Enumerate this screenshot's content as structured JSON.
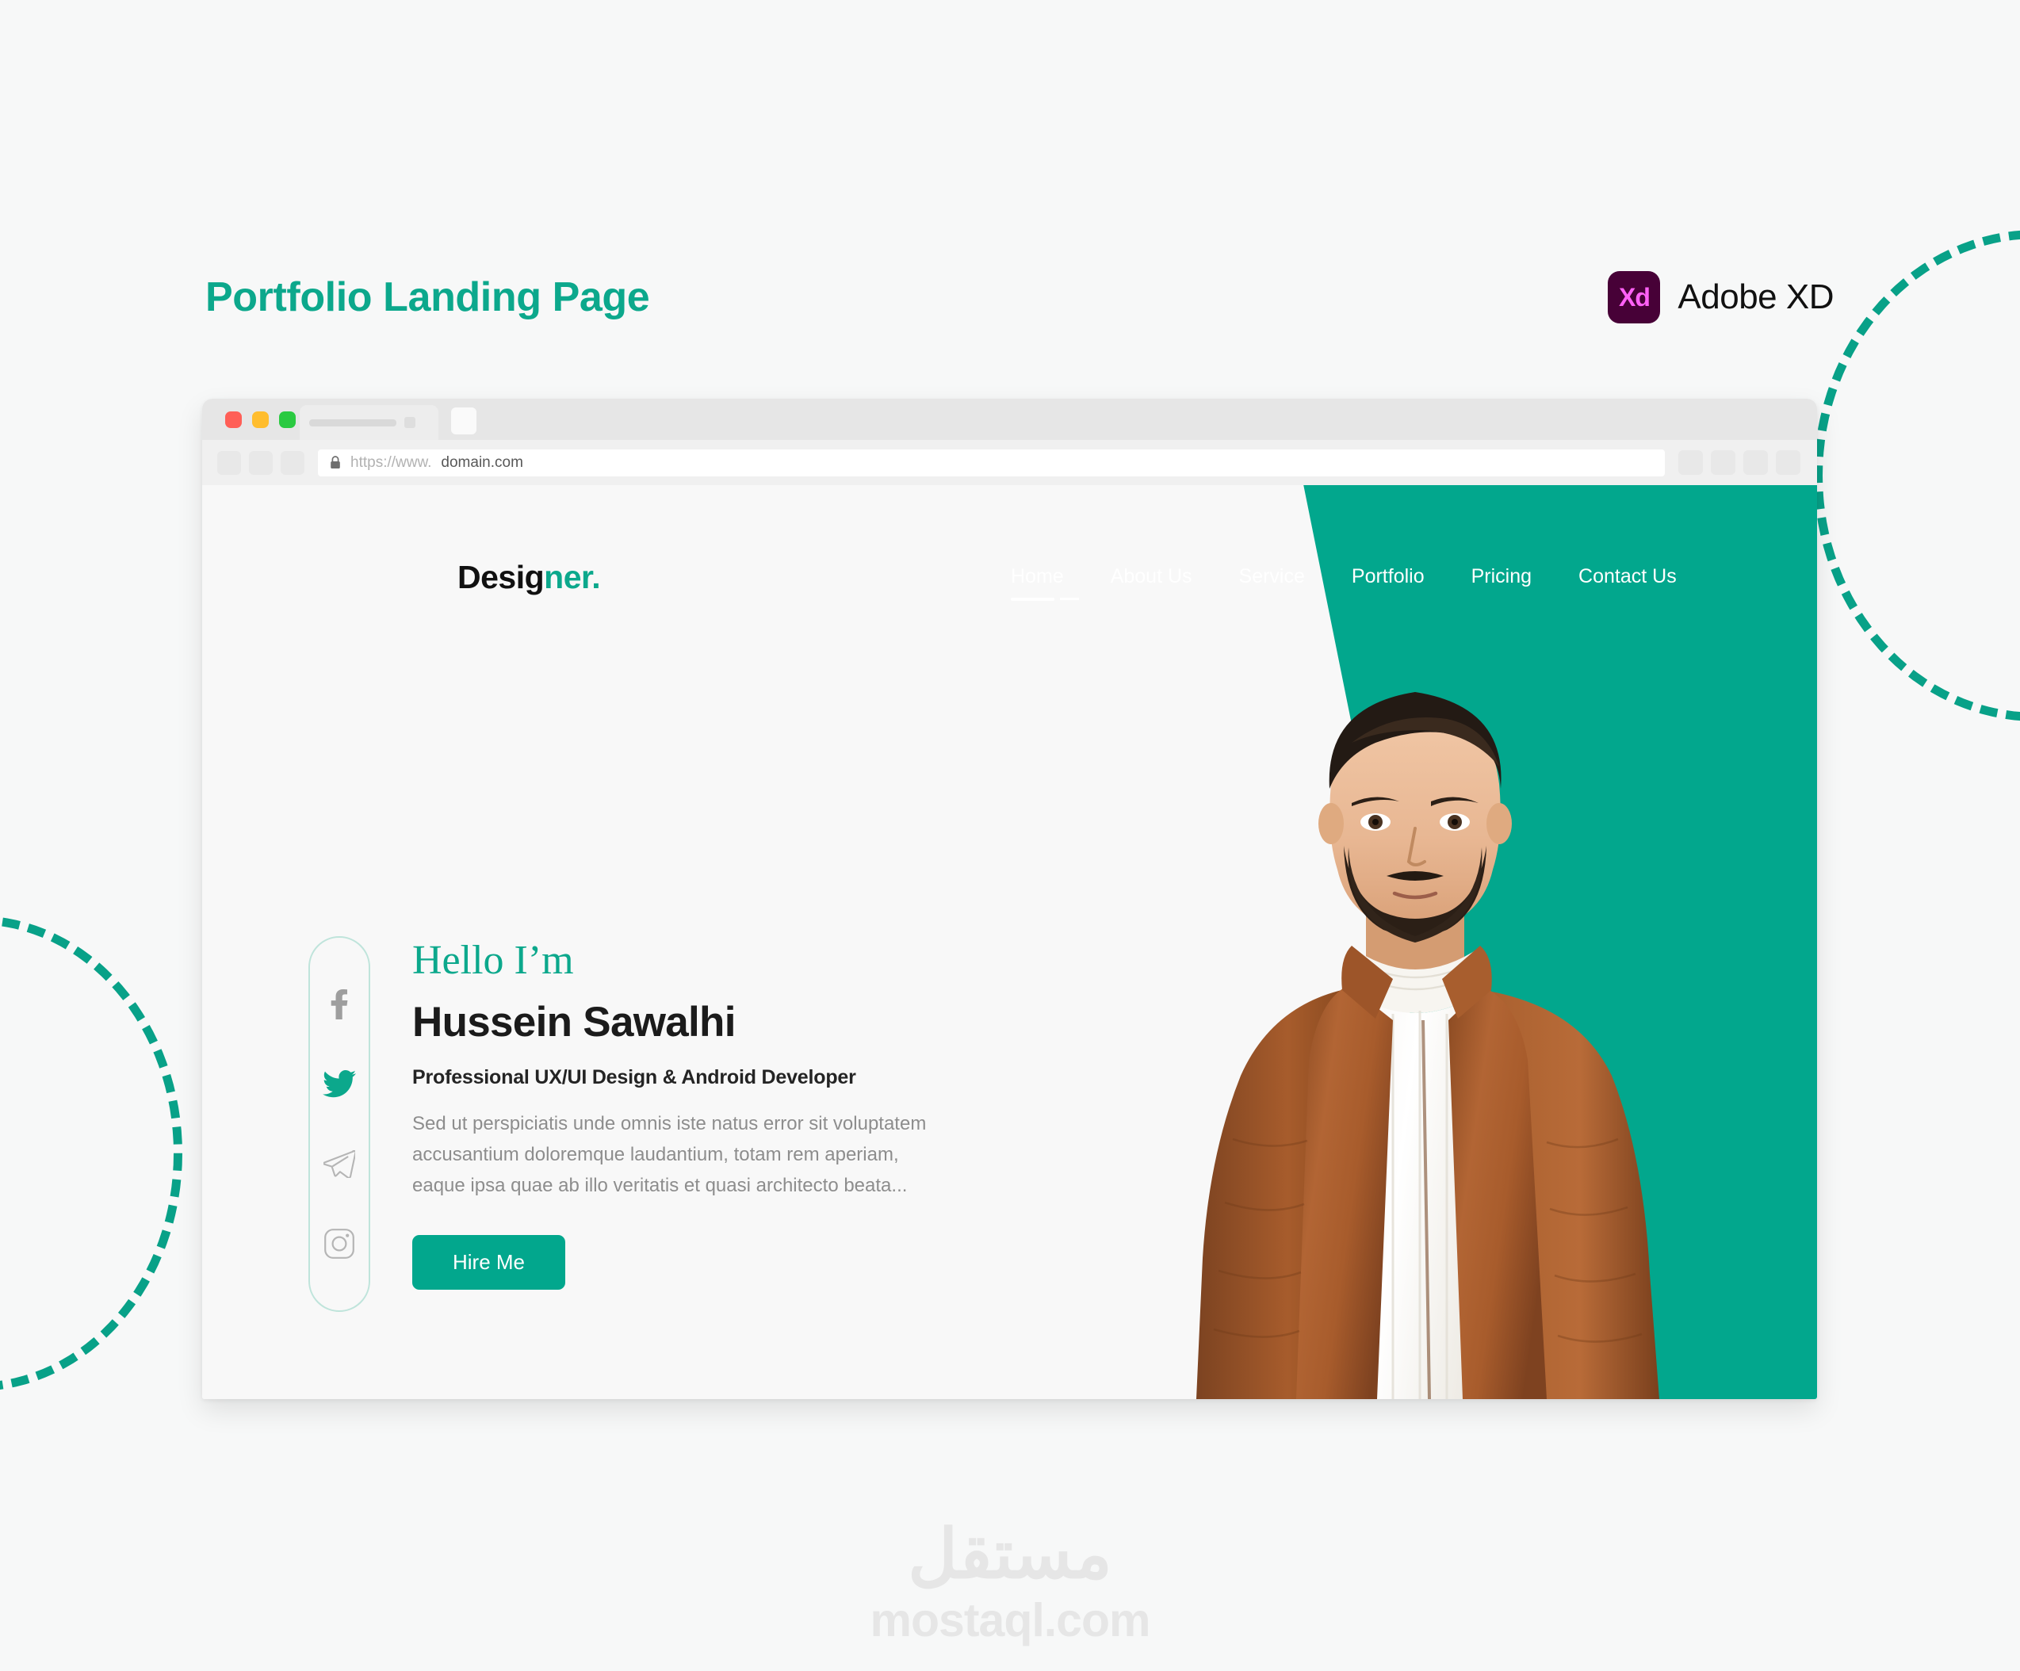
{
  "header": {
    "title": "Portfolio Landing Page",
    "tool": {
      "badge": "Xd",
      "label": "Adobe XD",
      "badge_bg": "#470137",
      "badge_fg": "#FF61F6"
    }
  },
  "browser": {
    "traffic_lights": [
      "#FF5F57",
      "#FFBD2E",
      "#2ACA41"
    ],
    "url": {
      "scheme": "https://www.",
      "domain": "domain.com",
      "lock_icon": "lock-icon"
    },
    "toolbar_icons": [
      "back-icon",
      "forward-icon",
      "reload-icon"
    ],
    "right_icons": [
      "extension-icon",
      "bookmark-icon",
      "profile-icon",
      "menu-icon"
    ]
  },
  "site": {
    "logo": {
      "dark": "Desig",
      "accent": "ner."
    },
    "nav": [
      {
        "label": "Home",
        "active": true
      },
      {
        "label": "About Us",
        "active": false
      },
      {
        "label": "Service",
        "active": false
      },
      {
        "label": "Portfolio",
        "active": false
      },
      {
        "label": "Pricing",
        "active": false
      },
      {
        "label": "Contact Us",
        "active": false
      }
    ],
    "social": [
      {
        "name": "facebook-icon",
        "color": "#9E9E9E"
      },
      {
        "name": "twitter-icon",
        "color": "#0CA88C"
      },
      {
        "name": "telegram-icon",
        "color": "#B5B5B5"
      },
      {
        "name": "instagram-icon",
        "color": "#B5B5B5"
      }
    ],
    "hero": {
      "greeting": "Hello I’m",
      "name": "Hussein Sawalhi",
      "role": "Professional UX/UI Design & Android Developer",
      "bio": "Sed ut perspiciatis unde omnis iste natus error sit voluptatem accusantium doloremque laudantium, totam rem aperiam, eaque ipsa quae ab illo veritatis et quasi architecto beata...",
      "cta": "Hire Me",
      "portrait_alt": "man-in-brown-leather-jacket-portrait"
    }
  },
  "watermark": {
    "arabic": "مستقل",
    "latin": "mostaql.com"
  },
  "colors": {
    "accent": "#02A78D",
    "accent_text": "#0CA88C",
    "page_bg": "#F7F8F8",
    "dashed": "#08A188"
  }
}
